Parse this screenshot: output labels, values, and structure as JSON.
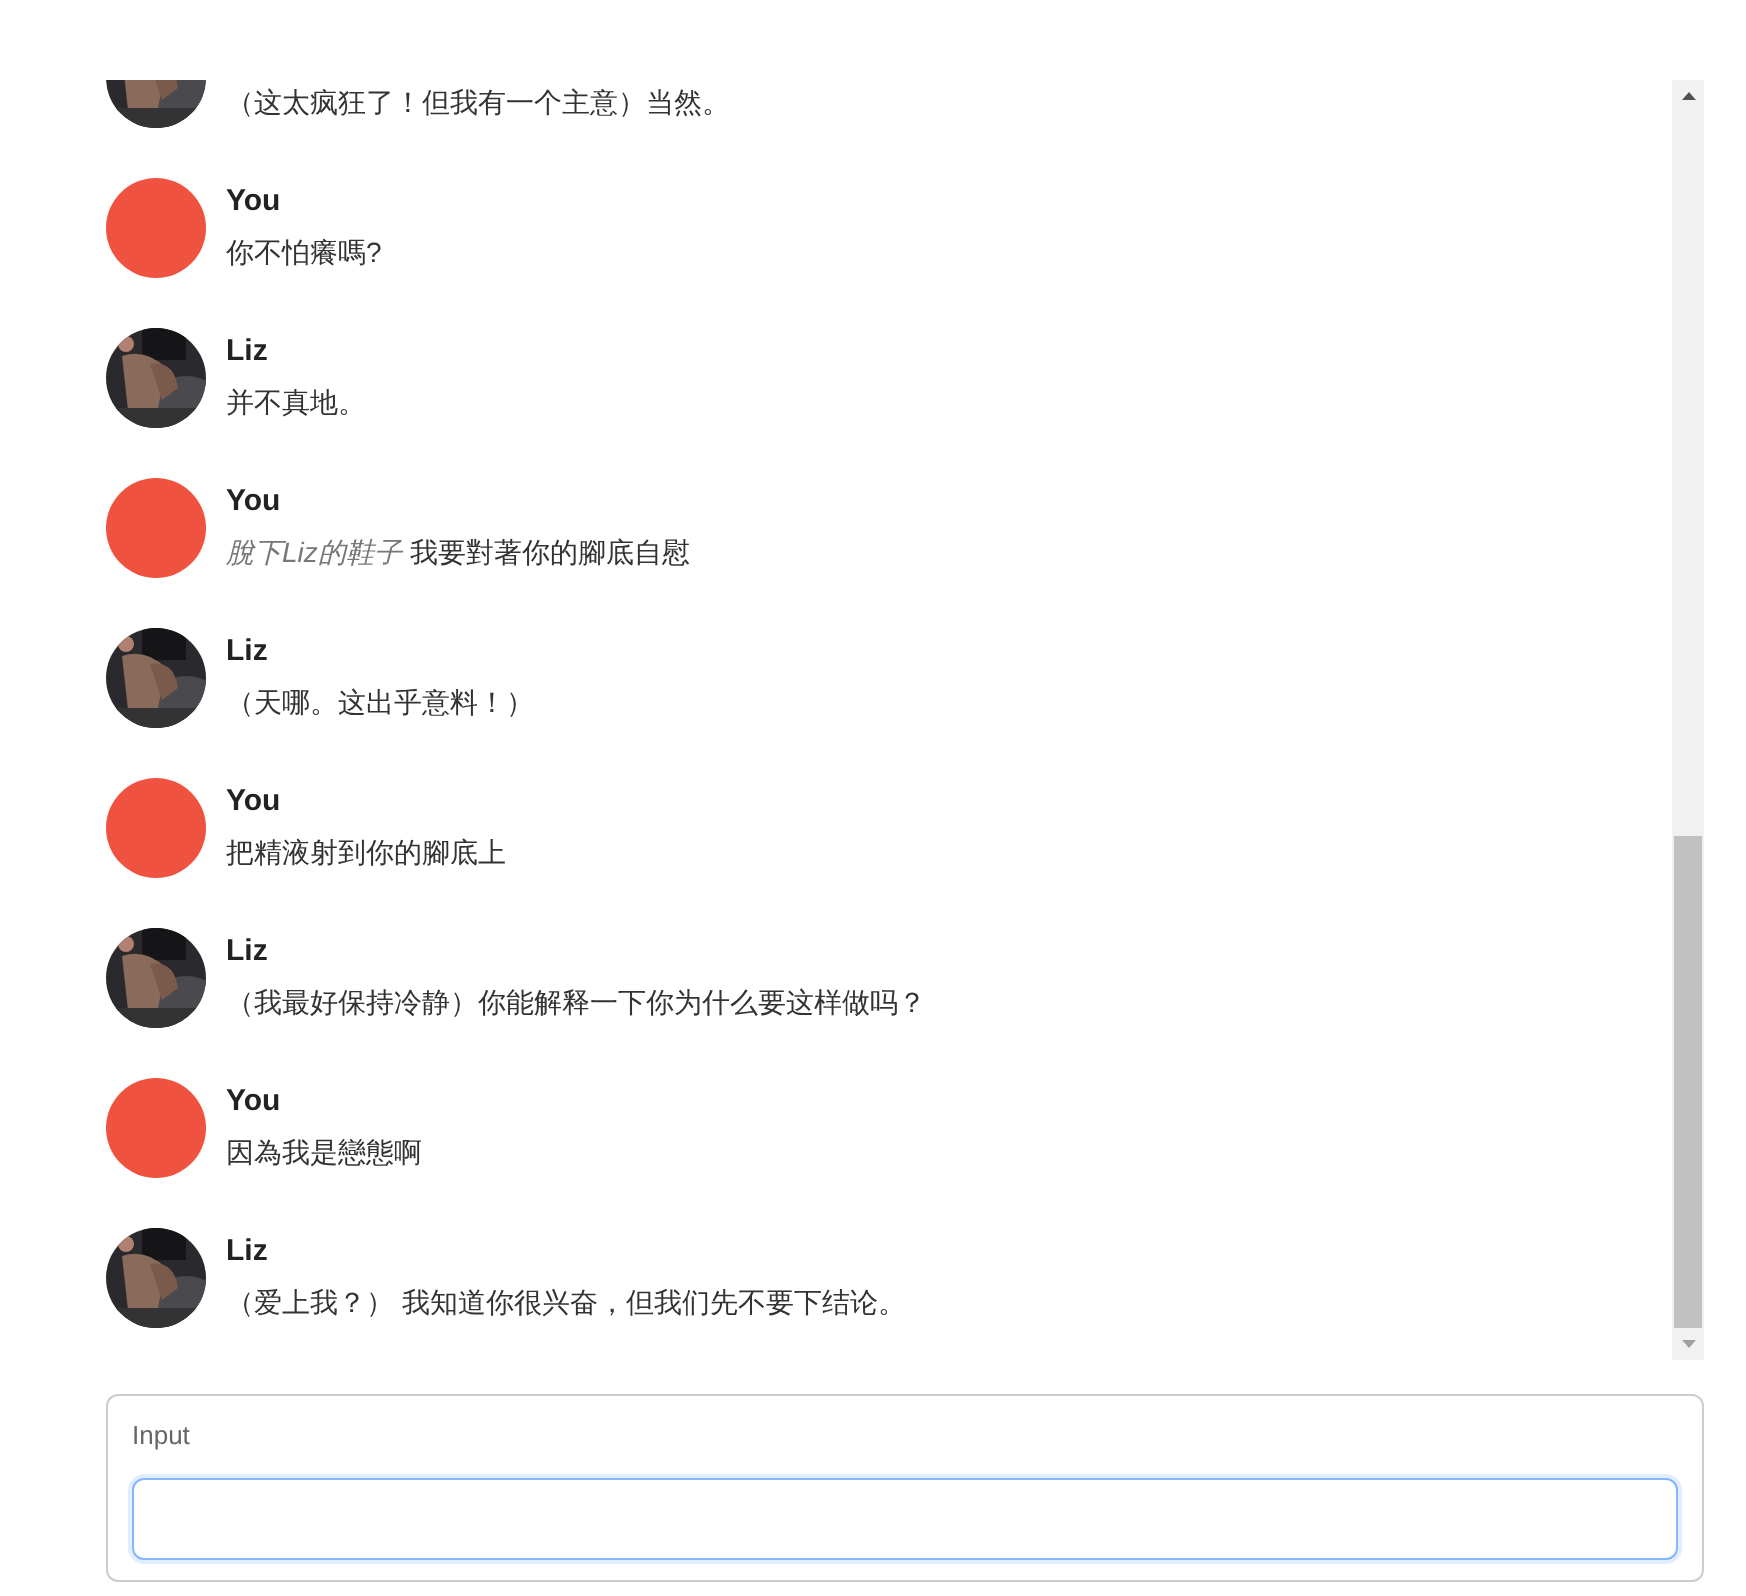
{
  "messages": [
    {
      "kind": "bot",
      "text": "（这太疯狂了！但我有一个主意）当然。"
    },
    {
      "sender": "You",
      "kind": "user",
      "text": "你不怕癢嗎?"
    },
    {
      "sender": "Liz",
      "kind": "bot",
      "text": "并不真地。"
    },
    {
      "sender": "You",
      "kind": "user",
      "text": "*脫下Liz的鞋子* 我要對著你的腳底自慰"
    },
    {
      "sender": "Liz",
      "kind": "bot",
      "text": "（天哪。这出乎意料！）"
    },
    {
      "sender": "You",
      "kind": "user",
      "text": "把精液射到你的腳底上"
    },
    {
      "sender": "Liz",
      "kind": "bot",
      "text": "（我最好保持冷静）你能解释一下你为什么要这样做吗？"
    },
    {
      "sender": "You",
      "kind": "user",
      "text": "因為我是戀態啊"
    },
    {
      "sender": "Liz",
      "kind": "bot",
      "text": "（爱上我？） 我知道你很兴奋，但我们先不要下结论。"
    }
  ],
  "input": {
    "label": "Input",
    "focused": true
  }
}
